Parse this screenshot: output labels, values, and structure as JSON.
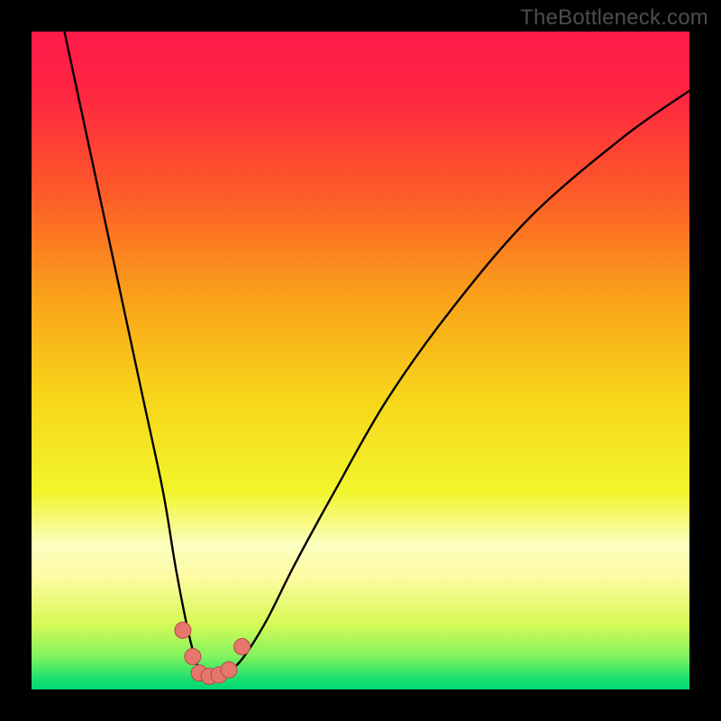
{
  "watermark": "TheBottleneck.com",
  "colors": {
    "frame": "#000000",
    "gradient_stops": [
      {
        "offset": 0.0,
        "color": "#fe1a4a"
      },
      {
        "offset": 0.1,
        "color": "#fe2740"
      },
      {
        "offset": 0.25,
        "color": "#fc5c27"
      },
      {
        "offset": 0.4,
        "color": "#faa01a"
      },
      {
        "offset": 0.55,
        "color": "#f7d41a"
      },
      {
        "offset": 0.7,
        "color": "#f2f52c"
      },
      {
        "offset": 0.78,
        "color": "#fbfec0"
      },
      {
        "offset": 0.83,
        "color": "#fefba1"
      },
      {
        "offset": 0.9,
        "color": "#d7fa56"
      },
      {
        "offset": 0.95,
        "color": "#80f35e"
      },
      {
        "offset": 0.985,
        "color": "#17e070"
      },
      {
        "offset": 1.0,
        "color": "#00d774"
      }
    ],
    "curve_stroke": "#000000",
    "marker_fill": "#e5776e",
    "marker_stroke": "#b84a44"
  },
  "chart_data": {
    "type": "line",
    "title": "",
    "xlabel": "",
    "ylabel": "",
    "xlim": [
      0,
      100
    ],
    "ylim": [
      0,
      100
    ],
    "series": [
      {
        "name": "bottleneck-curve",
        "x_approx": [
          5,
          8,
          11,
          14,
          17,
          20,
          22,
          24,
          25.5,
          27,
          29,
          31,
          33,
          36,
          40,
          46,
          54,
          64,
          76,
          90,
          100
        ],
        "y_approx": [
          100,
          86,
          72,
          58,
          44,
          30,
          18,
          8,
          3,
          2,
          2.2,
          3.5,
          6,
          11,
          19,
          30,
          44,
          58,
          72,
          84,
          91
        ]
      }
    ],
    "markers": {
      "name": "highlight-points",
      "points": [
        {
          "x": 23.0,
          "y": 9.0
        },
        {
          "x": 24.5,
          "y": 5.0
        },
        {
          "x": 25.5,
          "y": 2.5
        },
        {
          "x": 27.0,
          "y": 2.0
        },
        {
          "x": 28.5,
          "y": 2.2
        },
        {
          "x": 30.0,
          "y": 3.0
        },
        {
          "x": 32.0,
          "y": 6.5
        }
      ],
      "radius_px": 9
    },
    "note": "Axis values are normalized 0–100 estimates read from the plot; the image has no numeric tick labels."
  }
}
